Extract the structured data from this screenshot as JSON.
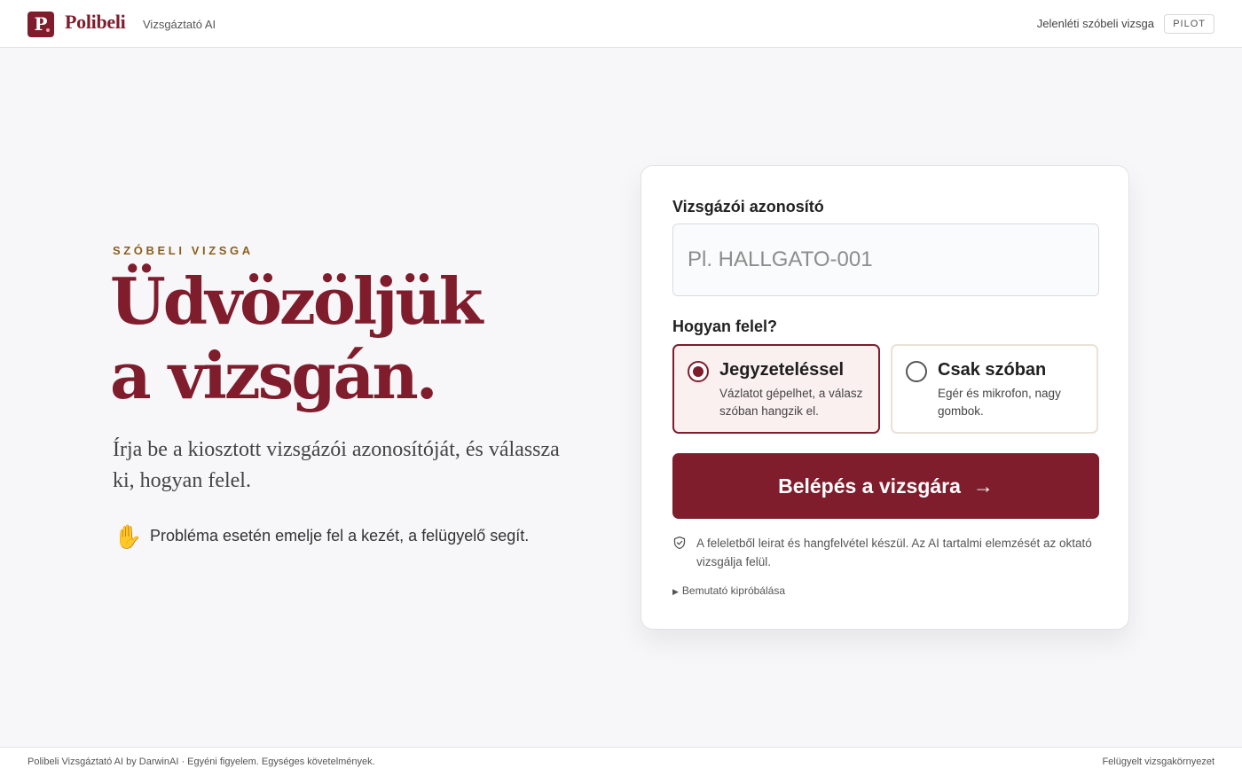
{
  "header": {
    "logo_letter": "P",
    "brand": "Polibeli",
    "subtitle": "Vizsgáztató AI",
    "nav_link": "Jelenléti szóbeli vizsga",
    "badge": "PILOT"
  },
  "hero": {
    "eyebrow": "SZÓBELI VIZSGA",
    "title_line1": "Üdvözöljük",
    "title_line2": "a vizsgán.",
    "lead": "Írja be a kiosztott vizsgázói azonosítóját, és válassza ki, hogyan felel.",
    "help_icon": "✋",
    "help_text": "Probléma esetén emelje fel a kezét, a felügyelő segít."
  },
  "form": {
    "id_label": "Vizsgázói azonosító",
    "id_placeholder": "Pl. HALLGATO-001",
    "id_value": "",
    "how_label": "Hogyan felel?",
    "options": [
      {
        "title": "Jegyzeteléssel",
        "desc": "Vázlatot gépelhet, a válasz szóban hangzik el.",
        "selected": true
      },
      {
        "title": "Csak szóban",
        "desc": "Egér és mikrofon, nagy gombok.",
        "selected": false
      }
    ],
    "submit_label": "Belépés a vizsgára",
    "submit_arrow": "→",
    "notice": "A feleletből leirat és hangfelvétel készül. Az AI tartalmi elemzését az oktató vizsgálja felül.",
    "demo_label": "Bemutató kipróbálása"
  },
  "footer": {
    "left": "Polibeli Vizsgáztató AI by DarwinAI · Egyéni figyelem. Egységes követelmények.",
    "right": "Felügyelt vizsgakörnyezet"
  },
  "colors": {
    "brand": "#7f1d2d",
    "eyebrow": "#8a5f1e",
    "background": "#f7f7f9"
  }
}
